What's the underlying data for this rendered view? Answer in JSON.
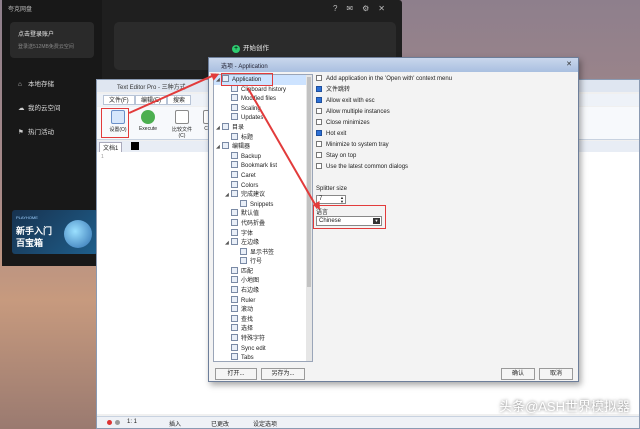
{
  "cloud_app": {
    "title": "夸克网盘",
    "login_main": "点击登录账户",
    "login_sub": "登录送512MB免费云空间",
    "nav": [
      {
        "icon": "home-icon",
        "label": "本地存储"
      },
      {
        "icon": "cloud-icon",
        "label": "我的云空间"
      },
      {
        "icon": "flag-icon",
        "label": "热门活动"
      }
    ],
    "banner": {
      "small": "PLAYHOME",
      "line1": "新手入门",
      "line2": "百宝箱"
    },
    "create_label": "开始创作"
  },
  "editor": {
    "title": "Text Editor Pro - 三种方式",
    "menus": [
      "文件(F)",
      "编辑(E)",
      "搜索"
    ],
    "ribbon": [
      {
        "label": "设置(O)",
        "icon": "settings-icon"
      },
      {
        "label": "Execute",
        "icon": "execute-icon"
      },
      {
        "label": "比较文件(C)",
        "icon": "compare-icon"
      },
      {
        "label": "Clipb",
        "icon": "clipboard-icon"
      }
    ],
    "doc_tab": "文档1",
    "line_number": "1",
    "status": [
      "1: 1",
      "插入",
      "已更改",
      "设定选项"
    ]
  },
  "dialog": {
    "title": "选项 - Application",
    "tree": [
      {
        "label": "Application",
        "level": 0,
        "expand": "◢",
        "selected": true
      },
      {
        "label": "Clipboard history",
        "level": 1
      },
      {
        "label": "Modified files",
        "level": 1
      },
      {
        "label": "Scaling",
        "level": 1
      },
      {
        "label": "Updates",
        "level": 1
      },
      {
        "label": "目录",
        "level": 0,
        "expand": "◢"
      },
      {
        "label": "标题",
        "level": 1
      },
      {
        "label": "编辑器",
        "level": 0,
        "expand": "◢"
      },
      {
        "label": "Backup",
        "level": 1
      },
      {
        "label": "Bookmark list",
        "level": 1
      },
      {
        "label": "Caret",
        "level": 1
      },
      {
        "label": "Colors",
        "level": 1
      },
      {
        "label": "完成建议",
        "level": 1,
        "expand": "◢"
      },
      {
        "label": "Snippets",
        "level": 2
      },
      {
        "label": "默认值",
        "level": 1
      },
      {
        "label": "代码折叠",
        "level": 1
      },
      {
        "label": "字体",
        "level": 1
      },
      {
        "label": "左边缘",
        "level": 1,
        "expand": "◢"
      },
      {
        "label": "显示书签",
        "level": 2
      },
      {
        "label": "行号",
        "level": 2
      },
      {
        "label": "匹配",
        "level": 1
      },
      {
        "label": "小地图",
        "level": 1
      },
      {
        "label": "右边缘",
        "level": 1
      },
      {
        "label": "Ruler",
        "level": 1
      },
      {
        "label": "滚动",
        "level": 1
      },
      {
        "label": "查找",
        "level": 1
      },
      {
        "label": "选择",
        "level": 1
      },
      {
        "label": "特殊字符",
        "level": 1
      },
      {
        "label": "Sync edit",
        "level": 1
      },
      {
        "label": "Tabs",
        "level": 1
      },
      {
        "label": "制表符",
        "level": 1
      }
    ],
    "options": [
      {
        "label": "Add application in the 'Open with' context menu",
        "checked": false
      },
      {
        "label": "文件跳转",
        "checked": true
      },
      {
        "label": "Allow exit with esc",
        "checked": true
      },
      {
        "label": "Allow multiple instances",
        "checked": false
      },
      {
        "label": "Close minimizes",
        "checked": false
      },
      {
        "label": "Hot exit",
        "checked": true
      },
      {
        "label": "Minimize to system tray",
        "checked": false
      },
      {
        "label": "Stay on top",
        "checked": false
      },
      {
        "label": "Use the latest common dialogs",
        "checked": false
      }
    ],
    "splitter_label": "Splitter size",
    "splitter_value": "7",
    "language_label": "语言",
    "language_value": "Chinese",
    "buttons": {
      "open": "打开...",
      "save_as": "另存为...",
      "ok": "确认",
      "cancel": "取消"
    }
  },
  "annotation_color": "#e23b3b",
  "watermark": "头条@ASH世界模拟器"
}
